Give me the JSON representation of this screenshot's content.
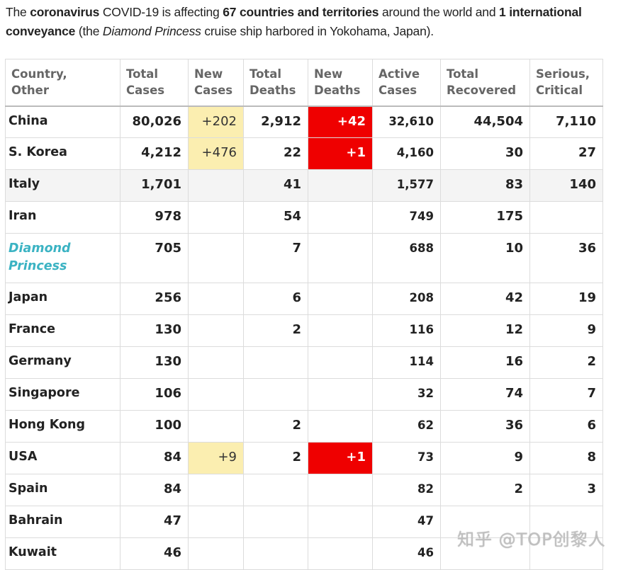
{
  "intro": {
    "t1": "The ",
    "b1": "coronavirus",
    "t2": " COVID-19 is affecting ",
    "b2": "67 countries and territories",
    "t3": " around the world and ",
    "b3": "1 international conveyance",
    "t4": " (the ",
    "i1": "Diamond Princess",
    "t5": " cruise ship harbored in Yokohama, Japan)."
  },
  "colors": {
    "new_cases_highlight": "#fbeeb0",
    "new_deaths_highlight": "#ef0000",
    "special_entry": "#3bb3c3",
    "header_text": "#666666"
  },
  "table": {
    "headers": [
      [
        "Country,",
        "Other"
      ],
      [
        "Total",
        "Cases"
      ],
      [
        "New",
        "Cases"
      ],
      [
        "Total",
        "Deaths"
      ],
      [
        "New",
        "Deaths"
      ],
      [
        "Active",
        "Cases"
      ],
      [
        "Total",
        "Recovered"
      ],
      [
        "Serious,",
        "Critical"
      ]
    ],
    "rows": [
      {
        "country": "China",
        "total_cases": "80,026",
        "new_cases": "+202",
        "total_deaths": "2,912",
        "new_deaths": "+42",
        "active_cases": "32,610",
        "total_recovered": "44,504",
        "serious_critical": "7,110"
      },
      {
        "country": "S. Korea",
        "total_cases": "4,212",
        "new_cases": "+476",
        "total_deaths": "22",
        "new_deaths": "+1",
        "active_cases": "4,160",
        "total_recovered": "30",
        "serious_critical": "27"
      },
      {
        "country": "Italy",
        "total_cases": "1,701",
        "new_cases": "",
        "total_deaths": "41",
        "new_deaths": "",
        "active_cases": "1,577",
        "total_recovered": "83",
        "serious_critical": "140"
      },
      {
        "country": "Iran",
        "total_cases": "978",
        "new_cases": "",
        "total_deaths": "54",
        "new_deaths": "",
        "active_cases": "749",
        "total_recovered": "175",
        "serious_critical": ""
      },
      {
        "country": "Diamond Princess",
        "country_line1": "Diamond",
        "country_line2": "Princess",
        "total_cases": "705",
        "new_cases": "",
        "total_deaths": "7",
        "new_deaths": "",
        "active_cases": "688",
        "total_recovered": "10",
        "serious_critical": "36"
      },
      {
        "country": "Japan",
        "total_cases": "256",
        "new_cases": "",
        "total_deaths": "6",
        "new_deaths": "",
        "active_cases": "208",
        "total_recovered": "42",
        "serious_critical": "19"
      },
      {
        "country": "France",
        "total_cases": "130",
        "new_cases": "",
        "total_deaths": "2",
        "new_deaths": "",
        "active_cases": "116",
        "total_recovered": "12",
        "serious_critical": "9"
      },
      {
        "country": "Germany",
        "total_cases": "130",
        "new_cases": "",
        "total_deaths": "",
        "new_deaths": "",
        "active_cases": "114",
        "total_recovered": "16",
        "serious_critical": "2"
      },
      {
        "country": "Singapore",
        "total_cases": "106",
        "new_cases": "",
        "total_deaths": "",
        "new_deaths": "",
        "active_cases": "32",
        "total_recovered": "74",
        "serious_critical": "7"
      },
      {
        "country": "Hong Kong",
        "total_cases": "100",
        "new_cases": "",
        "total_deaths": "2",
        "new_deaths": "",
        "active_cases": "62",
        "total_recovered": "36",
        "serious_critical": "6"
      },
      {
        "country": "USA",
        "total_cases": "84",
        "new_cases": "+9",
        "total_deaths": "2",
        "new_deaths": "+1",
        "active_cases": "73",
        "total_recovered": "9",
        "serious_critical": "8"
      },
      {
        "country": "Spain",
        "total_cases": "84",
        "new_cases": "",
        "total_deaths": "",
        "new_deaths": "",
        "active_cases": "82",
        "total_recovered": "2",
        "serious_critical": "3"
      },
      {
        "country": "Bahrain",
        "total_cases": "47",
        "new_cases": "",
        "total_deaths": "",
        "new_deaths": "",
        "active_cases": "47",
        "total_recovered": "",
        "serious_critical": ""
      },
      {
        "country": "Kuwait",
        "total_cases": "46",
        "new_cases": "",
        "total_deaths": "",
        "new_deaths": "",
        "active_cases": "46",
        "total_recovered": "",
        "serious_critical": ""
      }
    ]
  },
  "watermark": "知乎 @TOP创黎人"
}
